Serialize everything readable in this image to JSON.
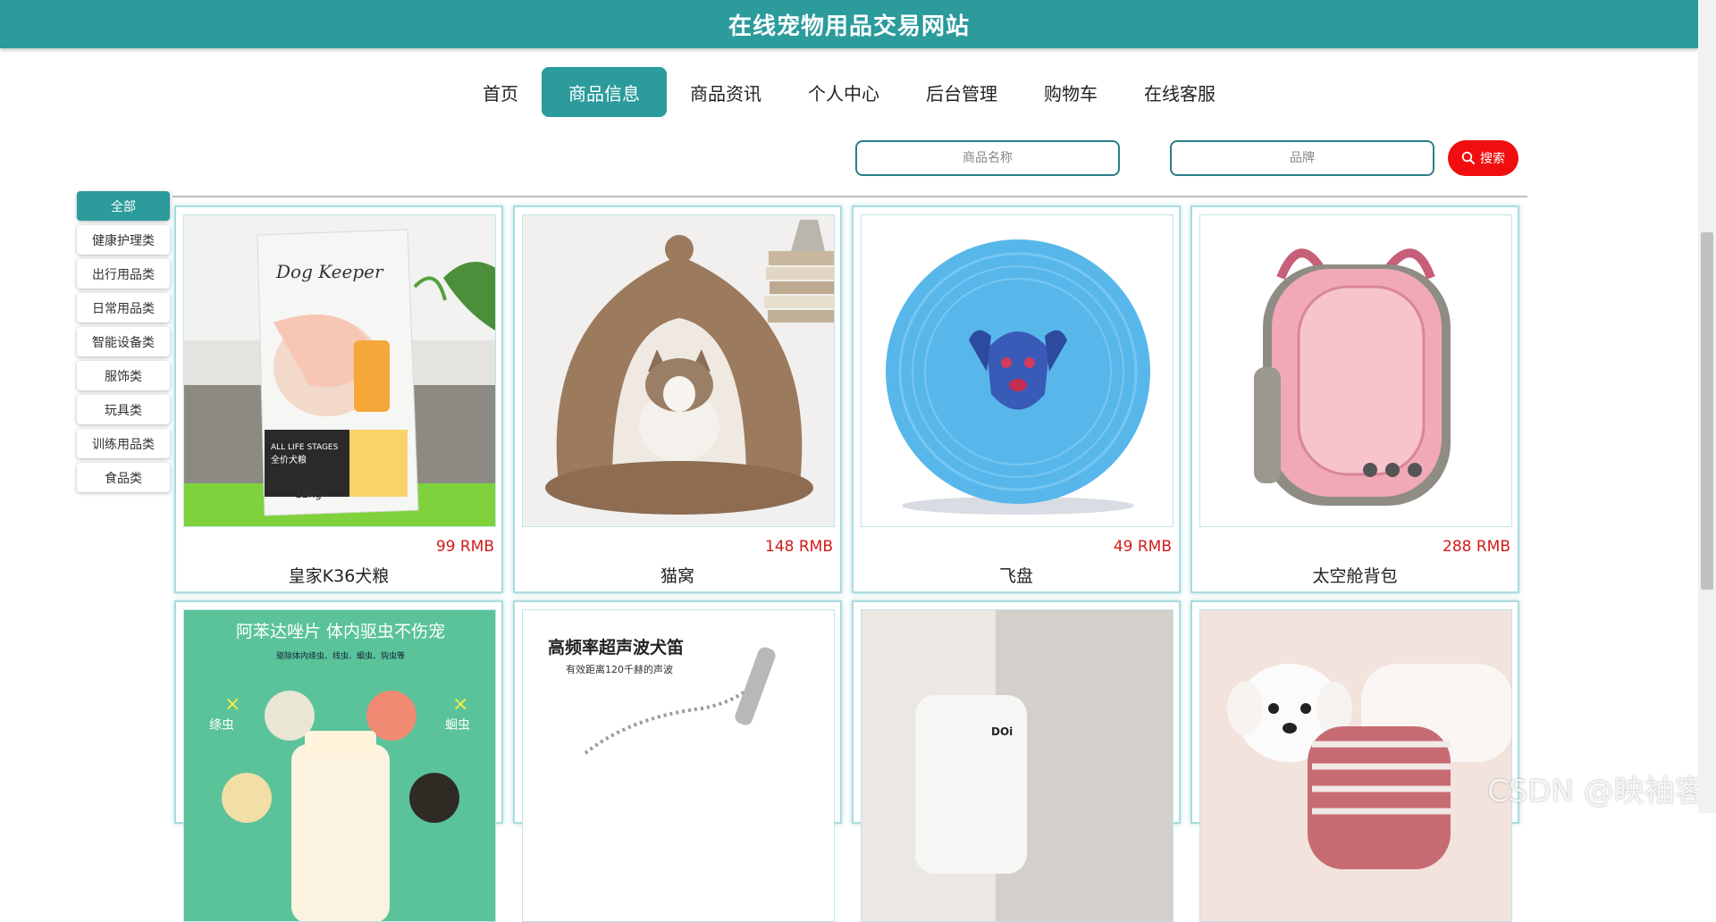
{
  "header": {
    "title": "在线宠物用品交易网站"
  },
  "nav": [
    {
      "label": "首页"
    },
    {
      "label": "商品信息"
    },
    {
      "label": "商品资讯"
    },
    {
      "label": "个人中心"
    },
    {
      "label": "后台管理"
    },
    {
      "label": "购物车"
    },
    {
      "label": "在线客服"
    }
  ],
  "active_nav": "商品信息",
  "search": {
    "name_placeholder": "商品名称",
    "brand_placeholder": "品牌",
    "button_label": "搜索"
  },
  "categories": [
    {
      "label": "全部"
    },
    {
      "label": "健康护理类"
    },
    {
      "label": "出行用品类"
    },
    {
      "label": "日常用品类"
    },
    {
      "label": "智能设备类"
    },
    {
      "label": "服饰类"
    },
    {
      "label": "玩具类"
    },
    {
      "label": "训练用品类"
    },
    {
      "label": "食品类"
    }
  ],
  "products": [
    {
      "name": "皇家K36犬粮",
      "price": "99 RMB",
      "image_text": {
        "brand": "Dog Keeper",
        "tag": "ALL LIFE STAGES",
        "tag_cn": "全价犬粮",
        "weight": "12kg"
      }
    },
    {
      "name": "猫窝",
      "price": "148 RMB"
    },
    {
      "name": "飞盘",
      "price": "49 RMB"
    },
    {
      "name": "太空舱背包",
      "price": "288 RMB"
    },
    {
      "name": "",
      "price": "",
      "image_text": {
        "headline": "阿苯达唑片 体内驱虫不伤宠",
        "sub": "驱除体内绦虫、线虫、蛔虫、钩虫等",
        "left": "绦虫",
        "right": "蛔虫"
      }
    },
    {
      "name": "",
      "price": "",
      "image_text": {
        "headline": "高频率超声波犬笛",
        "sub": "有效距离120千赫的声波"
      }
    },
    {
      "name": "",
      "price": "",
      "image_text": {
        "label": "DOi"
      }
    },
    {
      "name": "",
      "price": ""
    }
  ],
  "watermark": "CSDN @映袖客",
  "colors": {
    "primary": "#2b9b9c",
    "search_button": "#f00e0e",
    "price": "#d11b1b"
  }
}
